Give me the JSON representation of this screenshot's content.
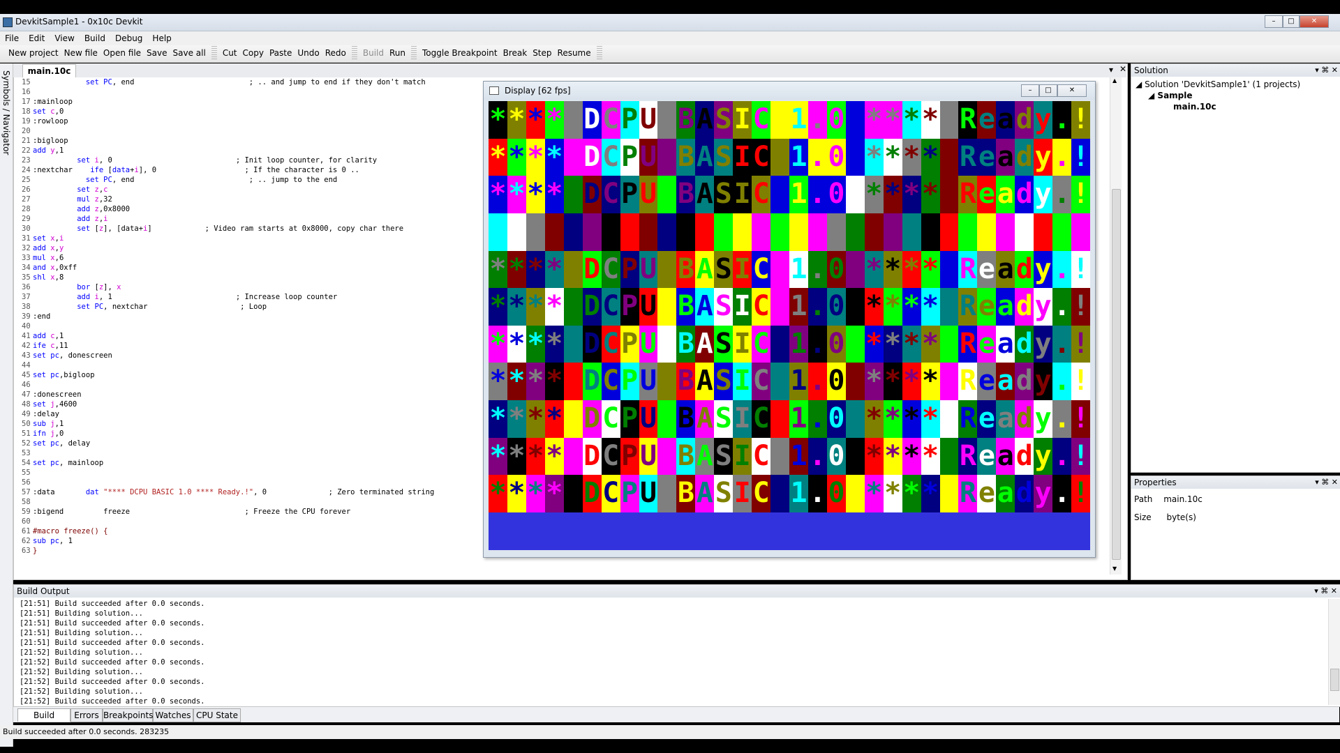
{
  "window": {
    "title": "DevkitSample1 - 0x10c Devkit"
  },
  "menu": [
    "File",
    "Edit",
    "View",
    "Build",
    "Debug",
    "Help"
  ],
  "toolbar": {
    "file": [
      "New project",
      "New file",
      "Open file",
      "Save",
      "Save all"
    ],
    "edit": [
      "Cut",
      "Copy",
      "Paste",
      "Undo",
      "Redo"
    ],
    "build": [
      "Build",
      "Run"
    ],
    "debug": [
      "Toggle Breakpoint",
      "Break",
      "Step",
      "Resume"
    ]
  },
  "side_tab": "Symbols / Navigator",
  "document": {
    "tab": "main.10c"
  },
  "code_lines": [
    {
      "n": "15",
      "tokens": [
        [
          "",
          "            "
        ],
        [
          "kw",
          "set"
        ],
        [
          "",
          " "
        ],
        [
          "kw",
          "PC"
        ],
        [
          "",
          ", end                          "
        ],
        [
          "cm",
          "; .. and jump to end if they don't match"
        ]
      ]
    },
    {
      "n": "16",
      "tokens": []
    },
    {
      "n": "17",
      "tokens": [
        [
          "",
          ":mainloop"
        ]
      ]
    },
    {
      "n": "18",
      "tokens": [
        [
          "kw",
          "set"
        ],
        [
          "",
          " "
        ],
        [
          "reg",
          "c"
        ],
        [
          "",
          ",0"
        ]
      ]
    },
    {
      "n": "19",
      "tokens": [
        [
          "",
          ":rowloop"
        ]
      ]
    },
    {
      "n": "20",
      "tokens": []
    },
    {
      "n": "21",
      "tokens": [
        [
          "",
          ":bigloop"
        ]
      ]
    },
    {
      "n": "22",
      "tokens": [
        [
          "kw",
          "add"
        ],
        [
          "",
          " "
        ],
        [
          "reg",
          "y"
        ],
        [
          "",
          ",1"
        ]
      ]
    },
    {
      "n": "23",
      "tokens": [
        [
          "",
          "          "
        ],
        [
          "kw",
          "set"
        ],
        [
          "",
          " "
        ],
        [
          "reg",
          "i"
        ],
        [
          "",
          ", 0                            "
        ],
        [
          "cm",
          "; Init loop counter, for clarity"
        ]
      ]
    },
    {
      "n": "24",
      "tokens": [
        [
          "",
          ":nextchar    "
        ],
        [
          "kw",
          "ife"
        ],
        [
          "",
          " ["
        ],
        [
          "kw",
          "data"
        ],
        [
          "",
          "+"
        ],
        [
          "reg",
          "i"
        ],
        [
          "",
          "], 0                    "
        ],
        [
          "cm",
          "; If the character is 0 .."
        ]
      ]
    },
    {
      "n": "25",
      "tokens": [
        [
          "",
          "            "
        ],
        [
          "kw",
          "set"
        ],
        [
          "",
          " "
        ],
        [
          "kw",
          "PC"
        ],
        [
          "",
          ", end                          "
        ],
        [
          "cm",
          "; .. jump to the end"
        ]
      ]
    },
    {
      "n": "26",
      "tokens": [
        [
          "",
          "          "
        ],
        [
          "kw",
          "set"
        ],
        [
          "",
          " "
        ],
        [
          "reg",
          "z"
        ],
        [
          "",
          ","
        ],
        [
          "reg",
          "c"
        ]
      ]
    },
    {
      "n": "27",
      "tokens": [
        [
          "",
          "          "
        ],
        [
          "kw",
          "mul"
        ],
        [
          "",
          " "
        ],
        [
          "reg",
          "z"
        ],
        [
          "",
          ",32"
        ]
      ]
    },
    {
      "n": "28",
      "tokens": [
        [
          "",
          "          "
        ],
        [
          "kw",
          "add"
        ],
        [
          "",
          " "
        ],
        [
          "reg",
          "z"
        ],
        [
          "",
          ",0x8000"
        ]
      ]
    },
    {
      "n": "29",
      "tokens": [
        [
          "",
          "          "
        ],
        [
          "kw",
          "add"
        ],
        [
          "",
          " "
        ],
        [
          "reg",
          "z"
        ],
        [
          "",
          ","
        ],
        [
          "reg",
          "i"
        ]
      ]
    },
    {
      "n": "30",
      "tokens": [
        [
          "",
          "          "
        ],
        [
          "kw",
          "set"
        ],
        [
          "",
          " ["
        ],
        [
          "reg",
          "z"
        ],
        [
          "",
          "], [data+"
        ],
        [
          "reg",
          "i"
        ],
        [
          "",
          "]            "
        ],
        [
          "cm",
          "; Video ram starts at 0x8000, copy char there"
        ]
      ]
    },
    {
      "n": "31",
      "tokens": [
        [
          "kw",
          "set"
        ],
        [
          "",
          " "
        ],
        [
          "reg",
          "x"
        ],
        [
          "",
          ","
        ],
        [
          "reg",
          "i"
        ]
      ]
    },
    {
      "n": "32",
      "tokens": [
        [
          "kw",
          "add"
        ],
        [
          "",
          " "
        ],
        [
          "reg",
          "x"
        ],
        [
          "",
          ","
        ],
        [
          "reg",
          "y"
        ]
      ]
    },
    {
      "n": "33",
      "tokens": [
        [
          "kw",
          "mul"
        ],
        [
          "",
          " "
        ],
        [
          "reg",
          "x"
        ],
        [
          "",
          ",6"
        ]
      ]
    },
    {
      "n": "34",
      "tokens": [
        [
          "kw",
          "and"
        ],
        [
          "",
          " "
        ],
        [
          "reg",
          "x"
        ],
        [
          "",
          ",0xff"
        ]
      ]
    },
    {
      "n": "35",
      "tokens": [
        [
          "kw",
          "shl"
        ],
        [
          "",
          " "
        ],
        [
          "reg",
          "x"
        ],
        [
          "",
          ",8"
        ]
      ]
    },
    {
      "n": "36",
      "tokens": [
        [
          "",
          "          "
        ],
        [
          "kw",
          "bor"
        ],
        [
          "",
          " ["
        ],
        [
          "reg",
          "z"
        ],
        [
          "",
          "], "
        ],
        [
          "reg",
          "x"
        ]
      ]
    },
    {
      "n": "37",
      "tokens": [
        [
          "",
          "          "
        ],
        [
          "kw",
          "add"
        ],
        [
          "",
          " "
        ],
        [
          "reg",
          "i"
        ],
        [
          "",
          ", 1                            "
        ],
        [
          "cm",
          "; Increase loop counter"
        ]
      ]
    },
    {
      "n": "38",
      "tokens": [
        [
          "",
          "          "
        ],
        [
          "kw",
          "set"
        ],
        [
          "",
          " "
        ],
        [
          "kw",
          "PC"
        ],
        [
          "",
          ", nextchar                     "
        ],
        [
          "cm",
          "; Loop"
        ]
      ]
    },
    {
      "n": "39",
      "tokens": [
        [
          "",
          ":end"
        ]
      ]
    },
    {
      "n": "40",
      "tokens": []
    },
    {
      "n": "41",
      "tokens": [
        [
          "kw",
          "add"
        ],
        [
          "",
          " "
        ],
        [
          "reg",
          "c"
        ],
        [
          "",
          ",1"
        ]
      ]
    },
    {
      "n": "42",
      "tokens": [
        [
          "kw",
          "ife"
        ],
        [
          "",
          " "
        ],
        [
          "reg",
          "c"
        ],
        [
          "",
          ",11"
        ]
      ]
    },
    {
      "n": "43",
      "tokens": [
        [
          "kw",
          "set"
        ],
        [
          "",
          " "
        ],
        [
          "kw",
          "pc"
        ],
        [
          "",
          ", donescreen"
        ]
      ]
    },
    {
      "n": "44",
      "tokens": []
    },
    {
      "n": "45",
      "tokens": [
        [
          "kw",
          "set"
        ],
        [
          "",
          " "
        ],
        [
          "kw",
          "pc"
        ],
        [
          "",
          ",bigloop"
        ]
      ]
    },
    {
      "n": "46",
      "tokens": []
    },
    {
      "n": "47",
      "tokens": [
        [
          "",
          ":donescreen"
        ]
      ]
    },
    {
      "n": "48",
      "tokens": [
        [
          "kw",
          "set"
        ],
        [
          "",
          " "
        ],
        [
          "reg",
          "j"
        ],
        [
          "",
          ",4600"
        ]
      ]
    },
    {
      "n": "49",
      "tokens": [
        [
          "",
          ":delay"
        ]
      ]
    },
    {
      "n": "50",
      "tokens": [
        [
          "kw",
          "sub"
        ],
        [
          "",
          " "
        ],
        [
          "reg",
          "j"
        ],
        [
          "",
          ",1"
        ]
      ]
    },
    {
      "n": "51",
      "tokens": [
        [
          "kw",
          "ifn"
        ],
        [
          "",
          " "
        ],
        [
          "reg",
          "j"
        ],
        [
          "",
          ",0"
        ]
      ]
    },
    {
      "n": "52",
      "tokens": [
        [
          "kw",
          "set"
        ],
        [
          "",
          " "
        ],
        [
          "kw",
          "pc"
        ],
        [
          "",
          ", delay"
        ]
      ]
    },
    {
      "n": "53",
      "tokens": []
    },
    {
      "n": "54",
      "tokens": [
        [
          "kw",
          "set"
        ],
        [
          "",
          " "
        ],
        [
          "kw",
          "pc"
        ],
        [
          "",
          ", mainloop"
        ]
      ]
    },
    {
      "n": "55",
      "tokens": []
    },
    {
      "n": "56",
      "tokens": []
    },
    {
      "n": "57",
      "tokens": [
        [
          "",
          ":data       "
        ],
        [
          "kw",
          "dat"
        ],
        [
          "",
          " "
        ],
        [
          "str",
          "\"**** DCPU BASIC 1.0 **** Ready.!\""
        ],
        [
          "",
          ", 0              "
        ],
        [
          "cm",
          "; Zero terminated string"
        ]
      ]
    },
    {
      "n": "58",
      "tokens": []
    },
    {
      "n": "59",
      "tokens": [
        [
          "",
          ":bigend         freeze                          "
        ],
        [
          "cm",
          "; Freeze the CPU forever"
        ]
      ]
    },
    {
      "n": "60",
      "tokens": []
    },
    {
      "n": "61",
      "tokens": [
        [
          "dir",
          "#macro freeze() {"
        ]
      ]
    },
    {
      "n": "62",
      "tokens": [
        [
          "kw",
          "sub"
        ],
        [
          "",
          " "
        ],
        [
          "kw",
          "pc"
        ],
        [
          "",
          ", 1"
        ]
      ]
    },
    {
      "n": "63",
      "tokens": [
        [
          "dir",
          "}"
        ]
      ]
    }
  ],
  "display": {
    "title": "Display [62 fps]",
    "colors": [
      "#000000",
      "#808000",
      "#ff0000",
      "#00ff00",
      "#ffff00",
      "#0000dd",
      "#ff00ff",
      "#00ffff",
      "#ffffff",
      "#7f7f7f",
      "#007f00",
      "#800000",
      "#000080",
      "#800080",
      "#008080"
    ],
    "rows": [
      "000050000001134434011",
      "111111000233011003100",
      "223300444567011003010",
      "333444555670023334001",
      "445566678901233400223",
      "556677890123345566701",
      "667789012344567899001",
      "778890123456678900112",
      "889901234566789011223",
      "990011223456789012334",
      "011223345678901234456"
    ],
    "chars": "**** DCPU BASIC 1.0 **** Ready.!",
    "fg_hint": "#3333dd"
  },
  "solution": {
    "title": "Solution",
    "tree": {
      "root": "Solution 'DevkitSample1' (1 projects)",
      "project": "Sample",
      "file": "main.10c"
    }
  },
  "properties": {
    "title": "Properties",
    "rows": [
      {
        "key": "Path",
        "value": "main.10c"
      },
      {
        "key": "Size",
        "value": "byte(s)"
      }
    ]
  },
  "build_output": {
    "title": "Build Output",
    "lines": [
      "[21:51] Build succeeded after 0.0 seconds.",
      "[21:51] Building solution...",
      "[21:51] Build succeeded after 0.0 seconds.",
      "[21:51] Building solution...",
      "[21:51] Build succeeded after 0.0 seconds.",
      "[21:52] Building solution...",
      "[21:52] Build succeeded after 0.0 seconds.",
      "[21:52] Building solution...",
      "[21:52] Build succeeded after 0.0 seconds.",
      "[21:52] Building solution...",
      "[21:52] Build succeeded after 0.0 seconds."
    ]
  },
  "bottom_tabs": [
    "Build Output",
    "Errors",
    "Breakpoints",
    "Watches",
    "CPU State"
  ],
  "status": "Build succeeded after 0.0 seconds.  283235"
}
